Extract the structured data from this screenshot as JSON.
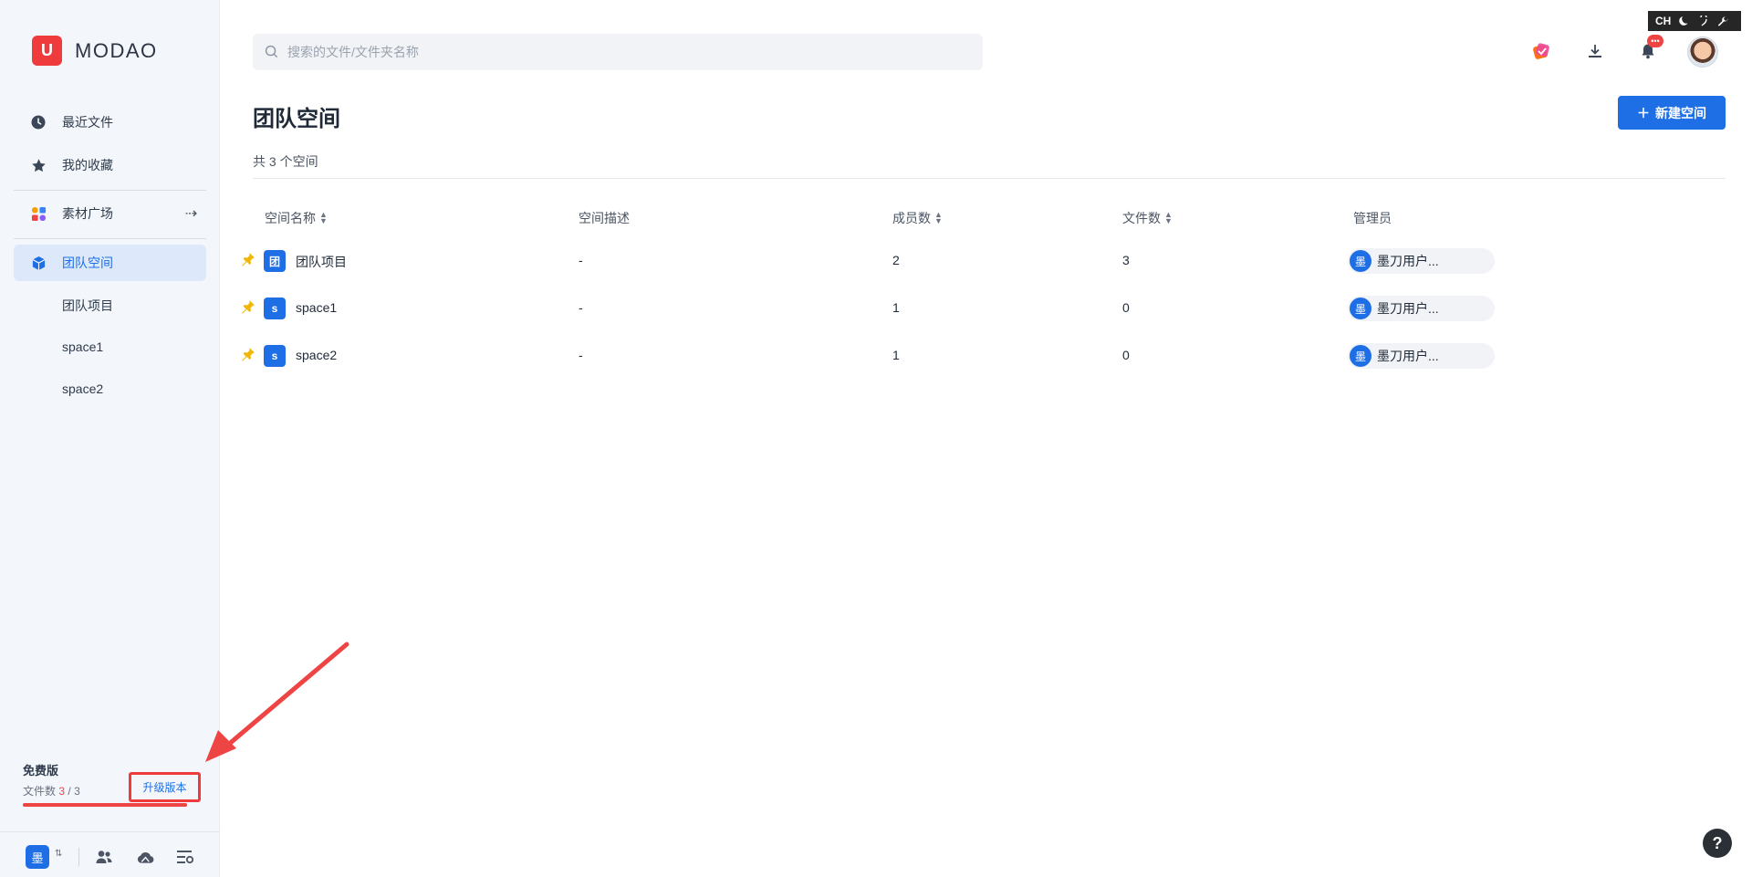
{
  "app": {
    "logo_text": "MODAO",
    "logo_mark": "U"
  },
  "sidebar": {
    "items": [
      {
        "label": "最近文件",
        "icon": "clock-icon"
      },
      {
        "label": "我的收藏",
        "icon": "star-icon"
      },
      {
        "label": "素材广场",
        "icon": "apps-icon",
        "arrow": "⇢"
      },
      {
        "label": "团队空间",
        "icon": "cube-icon",
        "active": true
      }
    ],
    "subitems": [
      "团队项目",
      "space1",
      "space2"
    ],
    "plan": {
      "name": "免费版",
      "files_label": "文件数",
      "used": "3",
      "sep": " / ",
      "total": "3",
      "usage_fraction": 1.0,
      "upgrade_label": "升级版本"
    },
    "bottom": {
      "team_avatar": "墨",
      "icons": [
        "members-icon",
        "cloud-icon",
        "settings-list-icon"
      ]
    }
  },
  "header": {
    "search_placeholder": "搜索的文件/文件夹名称",
    "icons": [
      "gift-icon",
      "download-icon",
      "bell-icon"
    ],
    "notif_badge": "•••",
    "devtool": {
      "label": "CH",
      "icons": [
        "moon-icon",
        "hook-icon",
        "wrench-icon"
      ]
    }
  },
  "main": {
    "title": "团队空间",
    "new_space_label": "新建空间",
    "count_text": "共 3 个空间",
    "columns": [
      "空间名称",
      "空间描述",
      "成员数",
      "文件数",
      "管理员"
    ],
    "rows": [
      {
        "icon": "团",
        "name": "团队项目",
        "desc": "-",
        "members": "2",
        "files": "3",
        "admin_av": "墨",
        "admin": "墨刀用户..."
      },
      {
        "icon": "s",
        "name": "space1",
        "desc": "-",
        "members": "1",
        "files": "0",
        "admin_av": "墨",
        "admin": "墨刀用户..."
      },
      {
        "icon": "s",
        "name": "space2",
        "desc": "-",
        "members": "1",
        "files": "0",
        "admin_av": "墨",
        "admin": "墨刀用户..."
      }
    ]
  },
  "help": {
    "label": "?"
  },
  "colors": {
    "accent": "#1e6fe5",
    "danger": "#ef4444",
    "pin": "#f2b705"
  }
}
